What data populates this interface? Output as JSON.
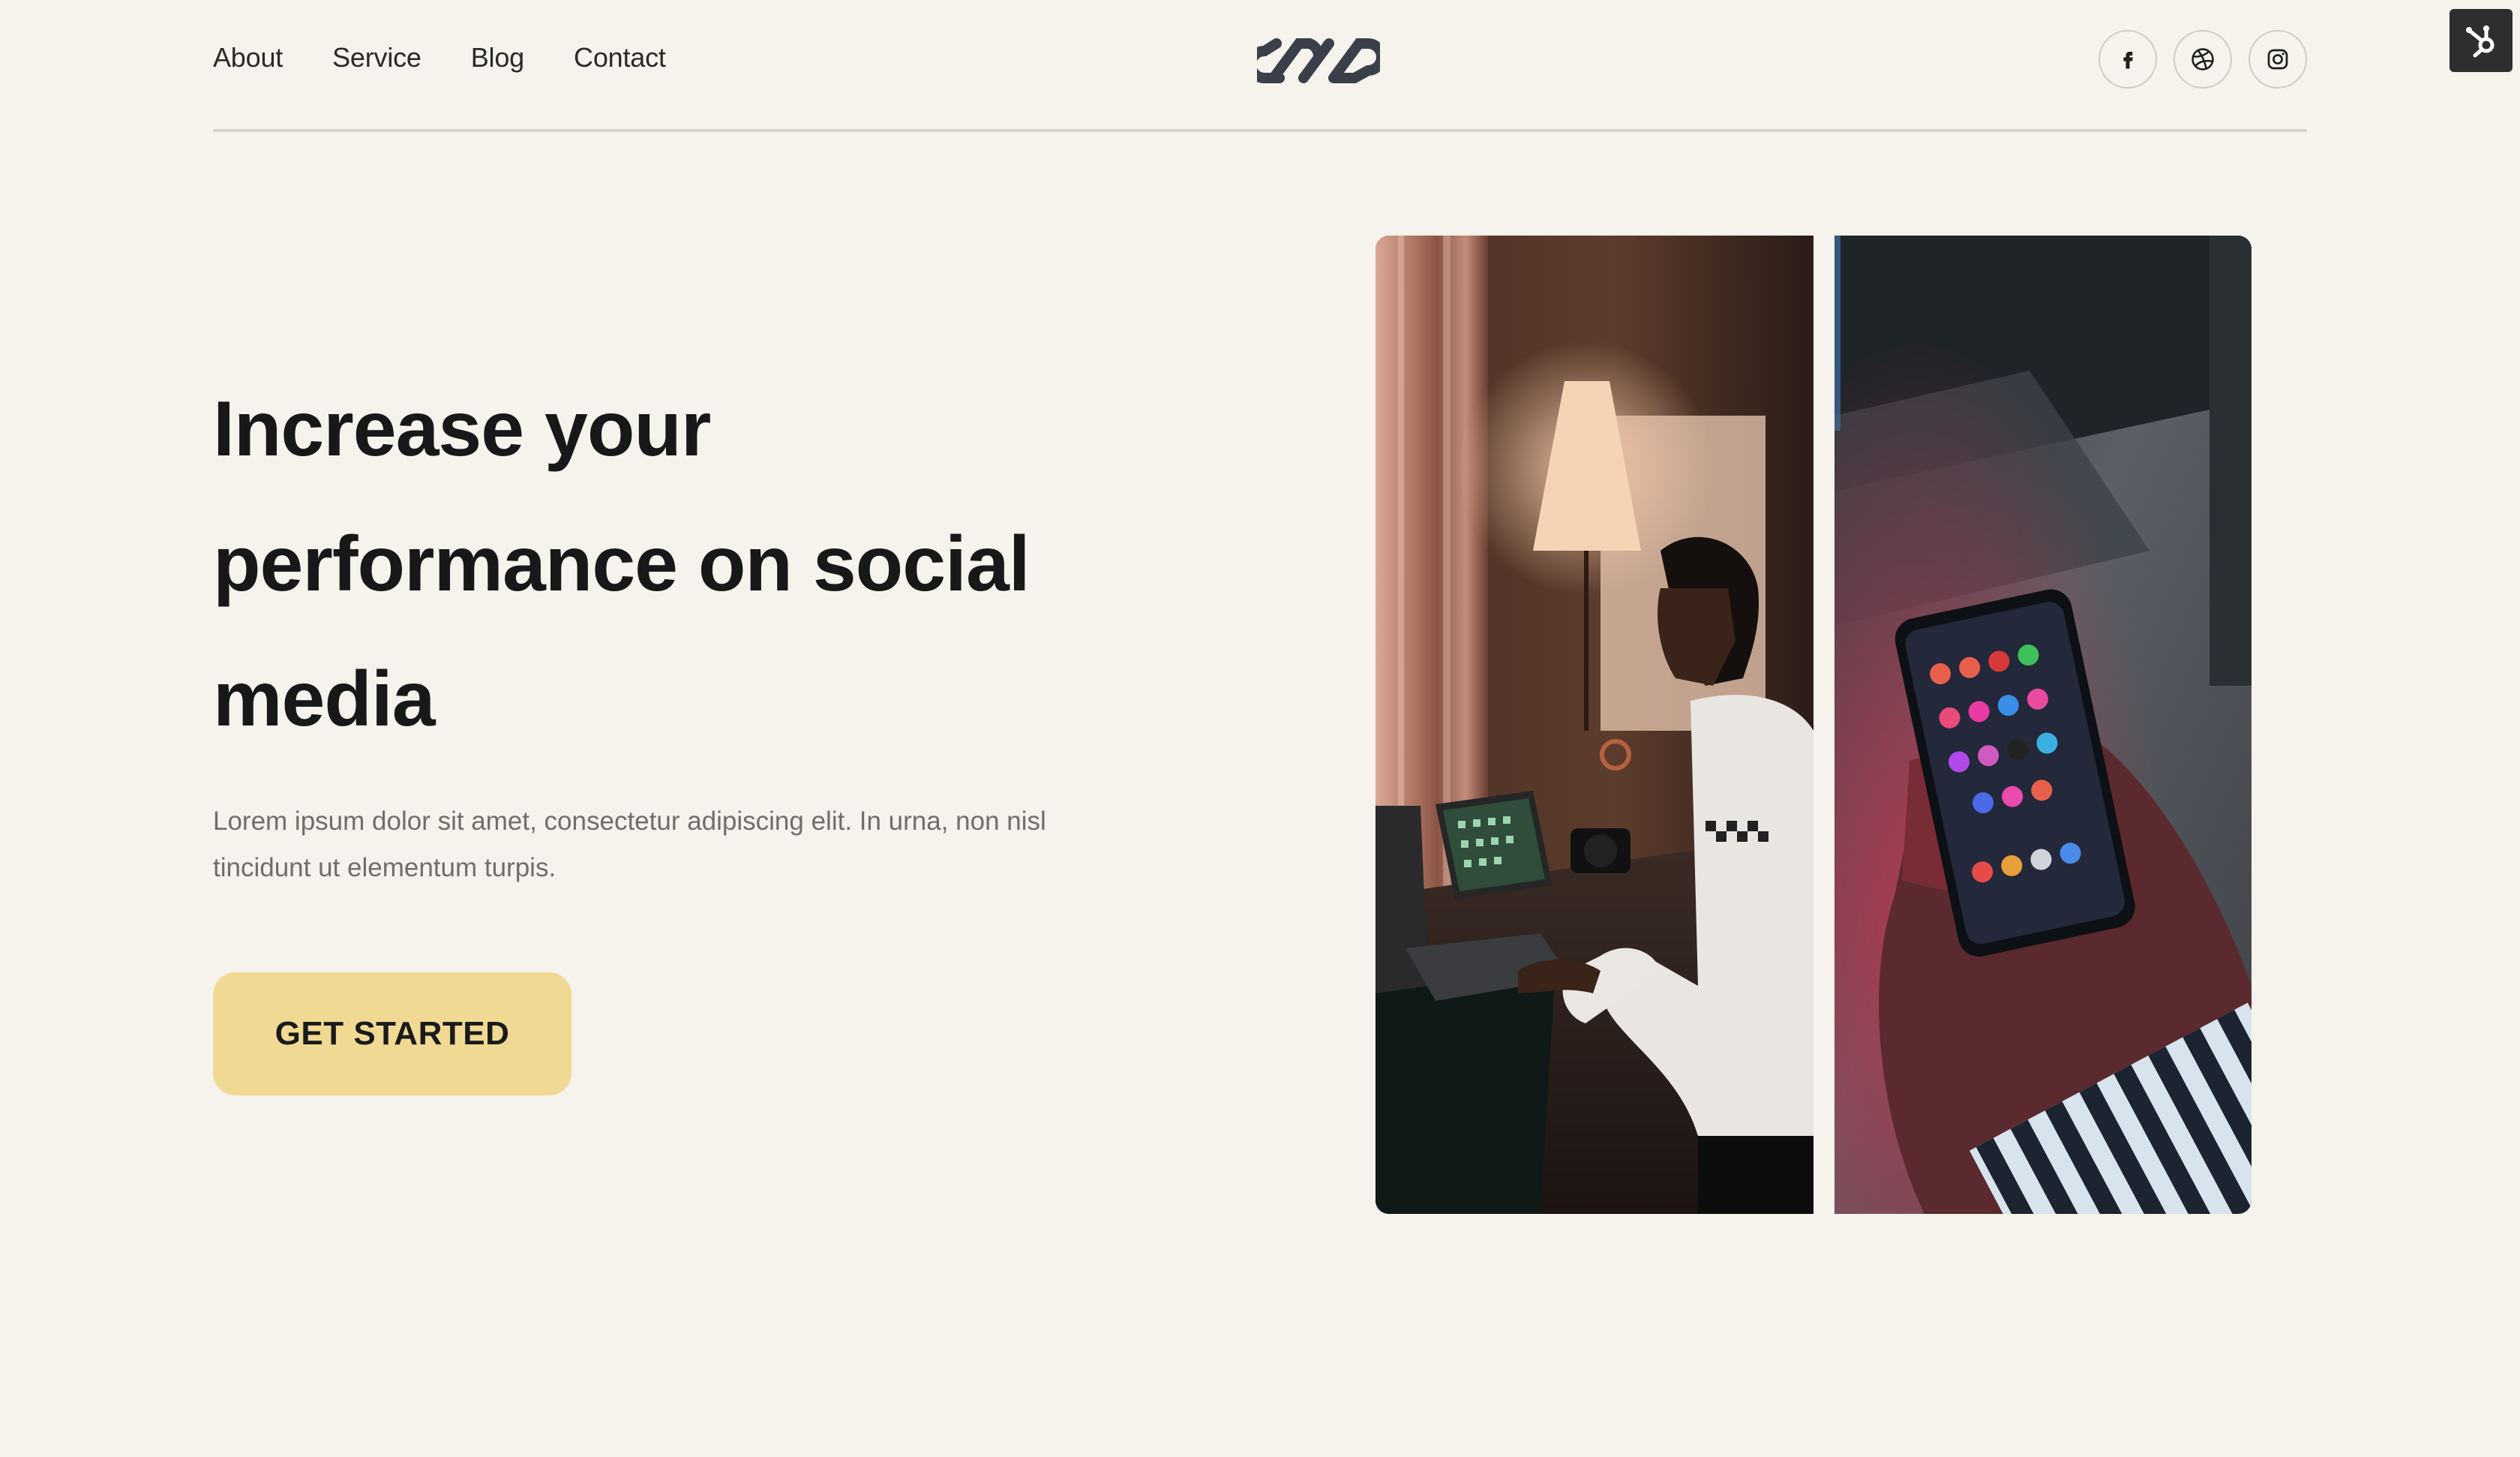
{
  "nav": {
    "items": [
      "About",
      "Service",
      "Blog",
      "Contact"
    ]
  },
  "logo": {
    "icon": "infinity-chain-logo",
    "color": "#3a3f4a"
  },
  "socials": [
    {
      "icon": "facebook-icon"
    },
    {
      "icon": "dribbble-icon"
    },
    {
      "icon": "instagram-icon"
    }
  ],
  "widget": {
    "icon": "hubspot-icon"
  },
  "hero": {
    "title": "Increase your performance on social media",
    "subtitle": "Lorem ipsum dolor sit amet, consectetur adipiscing elit. In urna, non nisl tincidunt ut elementum turpis.",
    "cta_label": "GET STARTED"
  },
  "images": [
    {
      "name": "man-working-at-desk-photo"
    },
    {
      "name": "hands-holding-phone-photo"
    }
  ],
  "colors": {
    "background": "#f6f2ec",
    "accent": "#f0d993",
    "text": "#1a1a1a",
    "muted": "#6f6e6c"
  }
}
